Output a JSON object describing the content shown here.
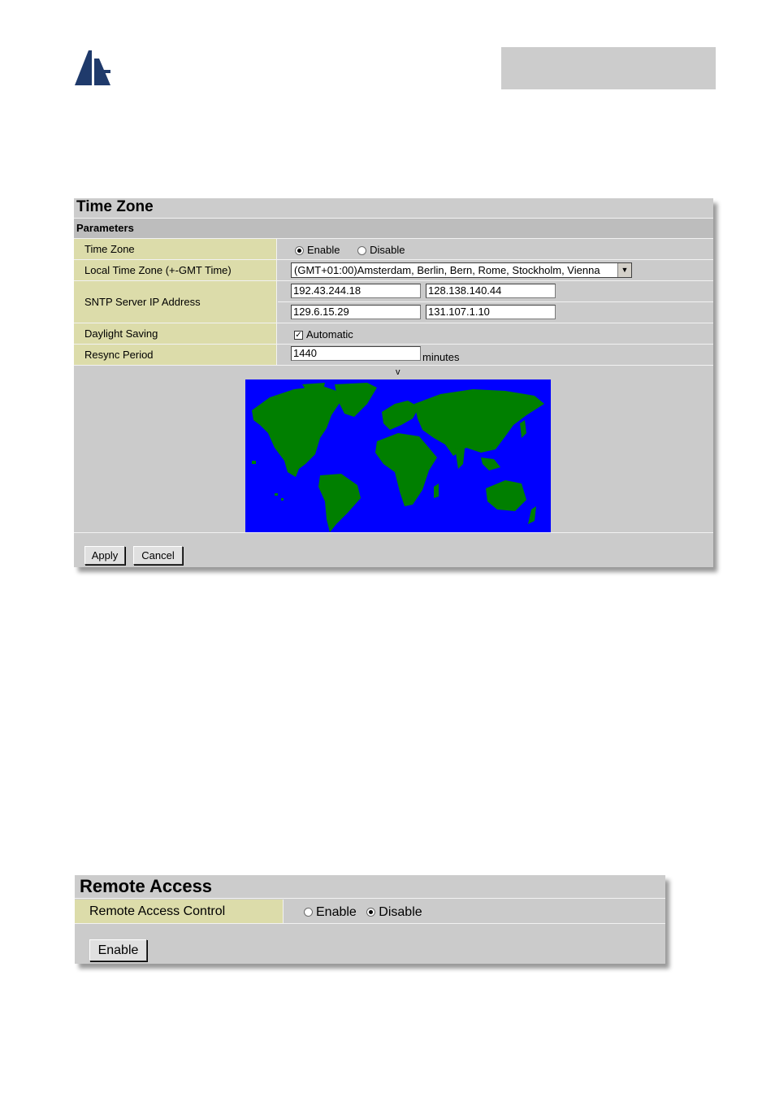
{
  "time_zone_panel": {
    "title": "Time Zone",
    "section": "Parameters",
    "rows": {
      "time_zone": {
        "label": "Time Zone",
        "enable_label": "Enable",
        "disable_label": "Disable",
        "selected": "Enable"
      },
      "local_tz": {
        "label": "Local Time Zone (+-GMT Time)",
        "value": "(GMT+01:00)Amsterdam, Berlin, Bern, Rome, Stockholm, Vienna"
      },
      "sntp": {
        "label": "SNTP Server IP Address",
        "servers": [
          "192.43.244.18",
          "128.138.140.44",
          "129.6.15.29",
          "131.107.1.10"
        ]
      },
      "daylight": {
        "label": "Daylight Saving",
        "checkbox_label": "Automatic",
        "checked": true
      },
      "resync": {
        "label": "Resync Period",
        "value": "1440",
        "unit": "minutes"
      }
    },
    "map_marker": "v",
    "apply_label": "Apply",
    "cancel_label": "Cancel"
  },
  "remote_access_panel": {
    "title": "Remote Access",
    "row_label": "Remote Access Control",
    "enable_label": "Enable",
    "disable_label": "Disable",
    "selected": "Disable",
    "button_label": "Enable"
  },
  "colors": {
    "label_bg": "#dcdcaa",
    "panel_bg": "#cbcbcb",
    "map_ocean": "#0000ff",
    "map_land": "#007f00"
  }
}
